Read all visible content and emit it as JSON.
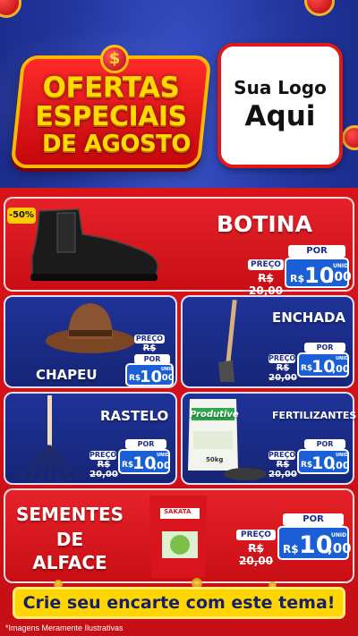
{
  "header": {
    "promo": {
      "line1": "OFERTAS",
      "line2": "ESPECIAIS",
      "line3": "DE AGOSTO",
      "coin_symbol": "$"
    },
    "logo": {
      "line1": "Sua Logo",
      "line2": "Aqui"
    }
  },
  "products": [
    {
      "name": "BOTINA",
      "discount_badge": "-50%",
      "preco_label": "PREÇO",
      "old_price": "R$ 20,00",
      "por_label": "POR",
      "currency": "R$",
      "price_int": "10",
      "price_dec": ",00",
      "unit": "UNID"
    },
    {
      "name": "CHAPEU",
      "preco_label": "PREÇO",
      "old_price": "R$ 20,00",
      "por_label": "POR",
      "currency": "R$",
      "price_int": "10",
      "price_dec": ",00",
      "unit": "UNID"
    },
    {
      "name": "ENCHADA",
      "preco_label": "PREÇO",
      "old_price": "R$ 20,00",
      "por_label": "POR",
      "currency": "R$",
      "price_int": "10",
      "price_dec": ",00",
      "unit": "UNID"
    },
    {
      "name": "RASTELO",
      "preco_label": "PREÇO",
      "old_price": "R$ 20,00",
      "por_label": "POR",
      "currency": "R$",
      "price_int": "10",
      "price_dec": ",00",
      "unit": "UNID"
    },
    {
      "name": "FERTILIZANTES",
      "bag_brand": "Produtive",
      "bag_weight": "50kg",
      "preco_label": "PREÇO",
      "old_price": "R$ 20,00",
      "por_label": "POR",
      "currency": "R$",
      "price_int": "10",
      "price_dec": ",00",
      "unit": "UNID"
    },
    {
      "name_line1": "SEMENTES",
      "name_line2": "DE",
      "name_line3": "ALFACE",
      "packet_brand": "SAKATA",
      "preco_label": "PREÇO",
      "old_price": "R$ 20,00",
      "por_label": "POR",
      "currency": "R$",
      "price_int": "10",
      "price_dec": ",00",
      "unit": "UNID"
    }
  ],
  "cta": "Crie seu encarte com este tema!",
  "disclaimer": "*Imagens Meramente Ilustrativas",
  "colors": {
    "brand_red": "#d9131a",
    "brand_blue": "#1f3398",
    "accent_yellow": "#ffd500",
    "price_blue": "#1b5fd6"
  }
}
